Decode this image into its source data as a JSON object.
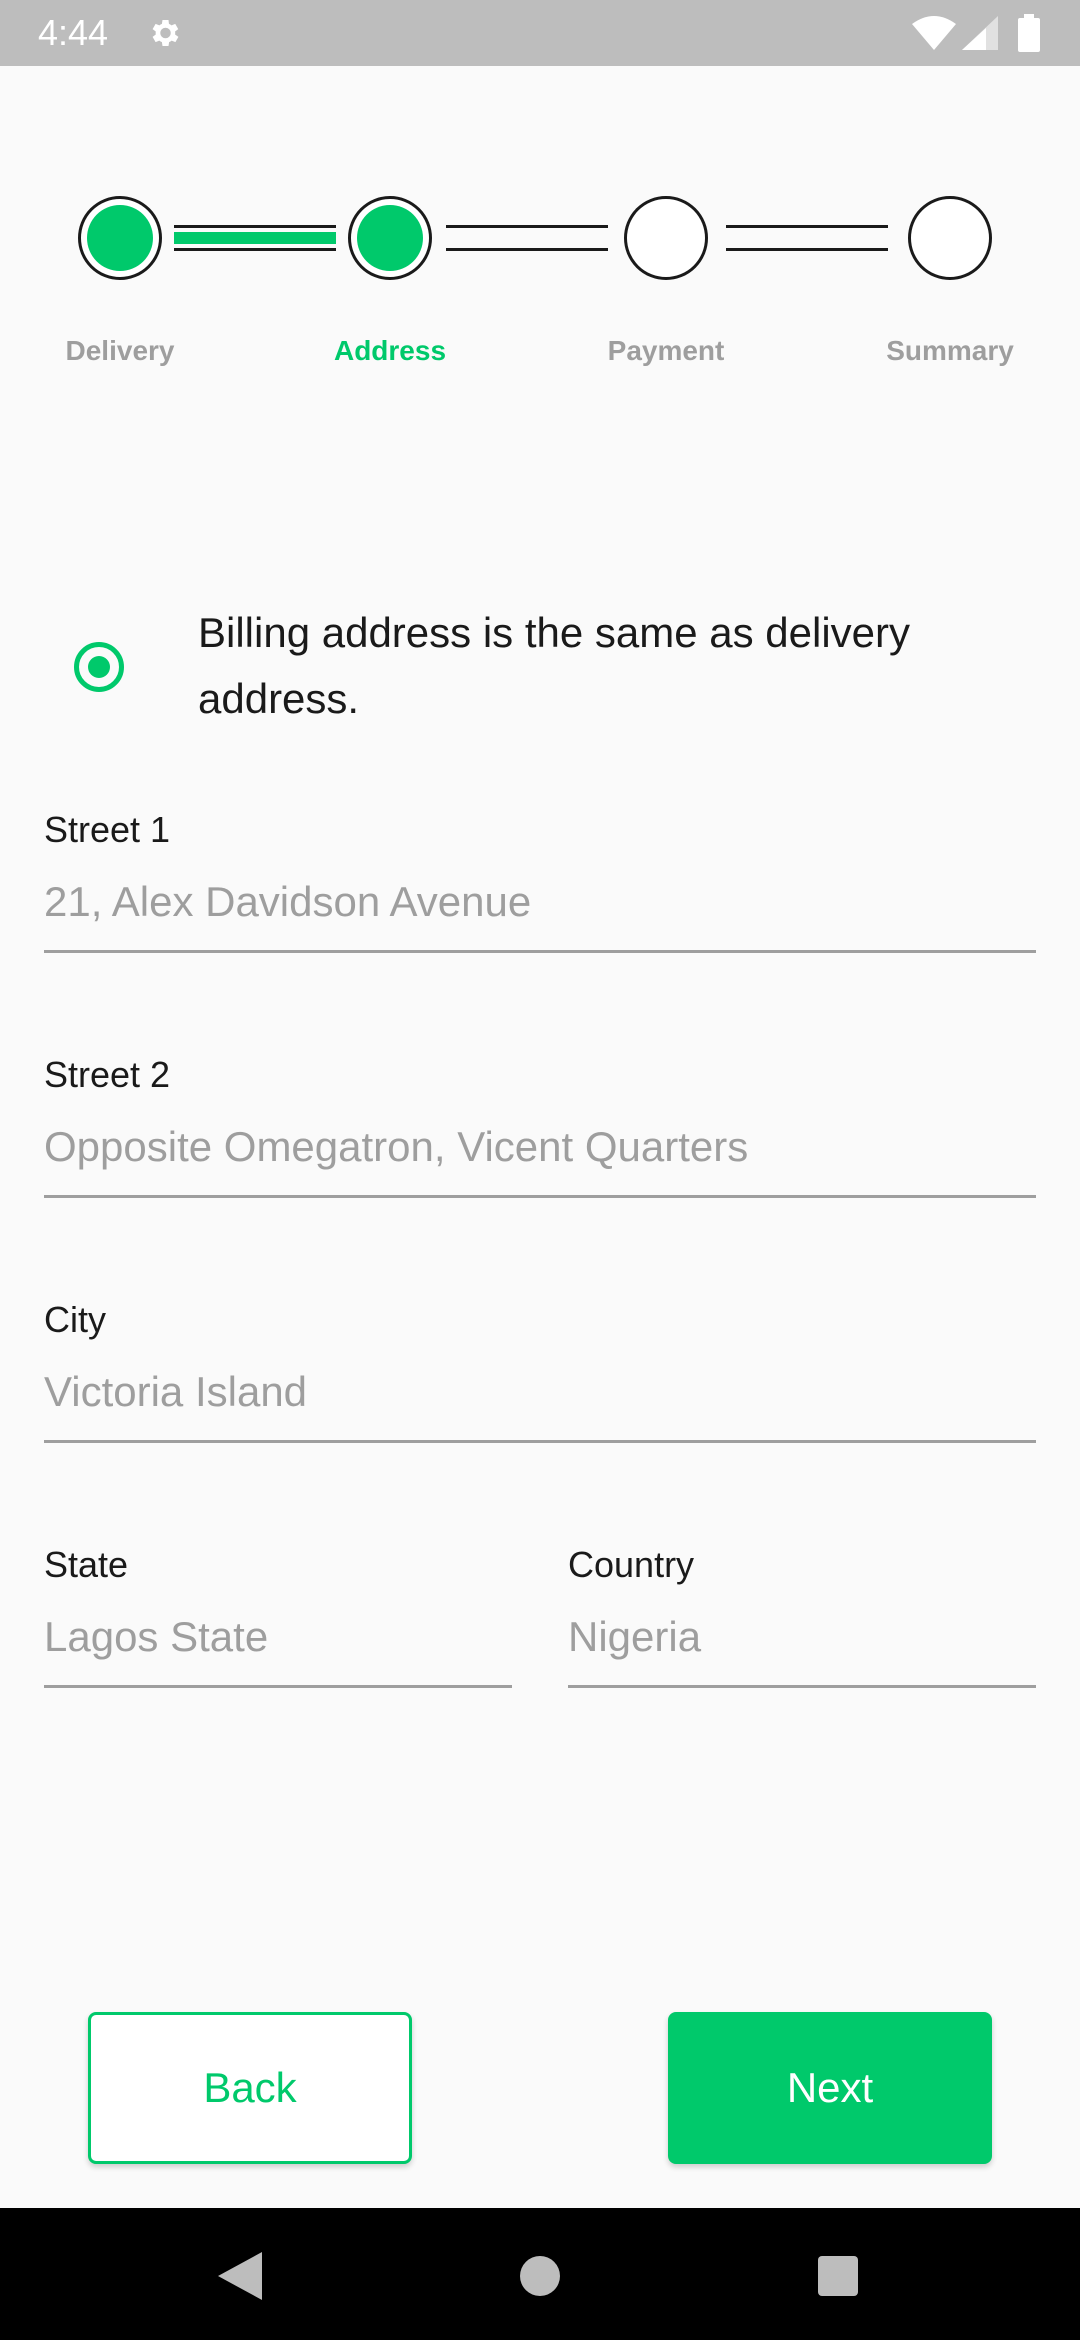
{
  "status_bar": {
    "time": "4:44",
    "icons": [
      "gear-icon",
      "wifi-icon",
      "signal-icon",
      "battery-icon"
    ]
  },
  "stepper": {
    "steps": [
      {
        "label": "Delivery",
        "completed": true,
        "active": false
      },
      {
        "label": "Address",
        "completed": true,
        "active": true
      },
      {
        "label": "Payment",
        "completed": false,
        "active": false
      },
      {
        "label": "Summary",
        "completed": false,
        "active": false
      }
    ]
  },
  "billing": {
    "same_as_delivery_label": "Billing address is the same as delivery address.",
    "same_as_delivery_selected": true
  },
  "form": {
    "street1": {
      "label": "Street 1",
      "placeholder": "21, Alex Davidson Avenue"
    },
    "street2": {
      "label": "Street 2",
      "placeholder": "Opposite Omegatron, Vicent Quarters"
    },
    "city": {
      "label": "City",
      "placeholder": "Victoria Island"
    },
    "state": {
      "label": "State",
      "placeholder": "Lagos State"
    },
    "country": {
      "label": "Country",
      "placeholder": "Nigeria"
    }
  },
  "actions": {
    "back_label": "Back",
    "next_label": "Next"
  },
  "nav_bar": {
    "icons": [
      "back-triangle-icon",
      "home-circle-icon",
      "recents-square-icon"
    ]
  },
  "colors": {
    "accent": "#00c96b",
    "status_bar": "#bdbdbd",
    "background": "#fafafa",
    "muted_text": "#9e9e9e"
  }
}
